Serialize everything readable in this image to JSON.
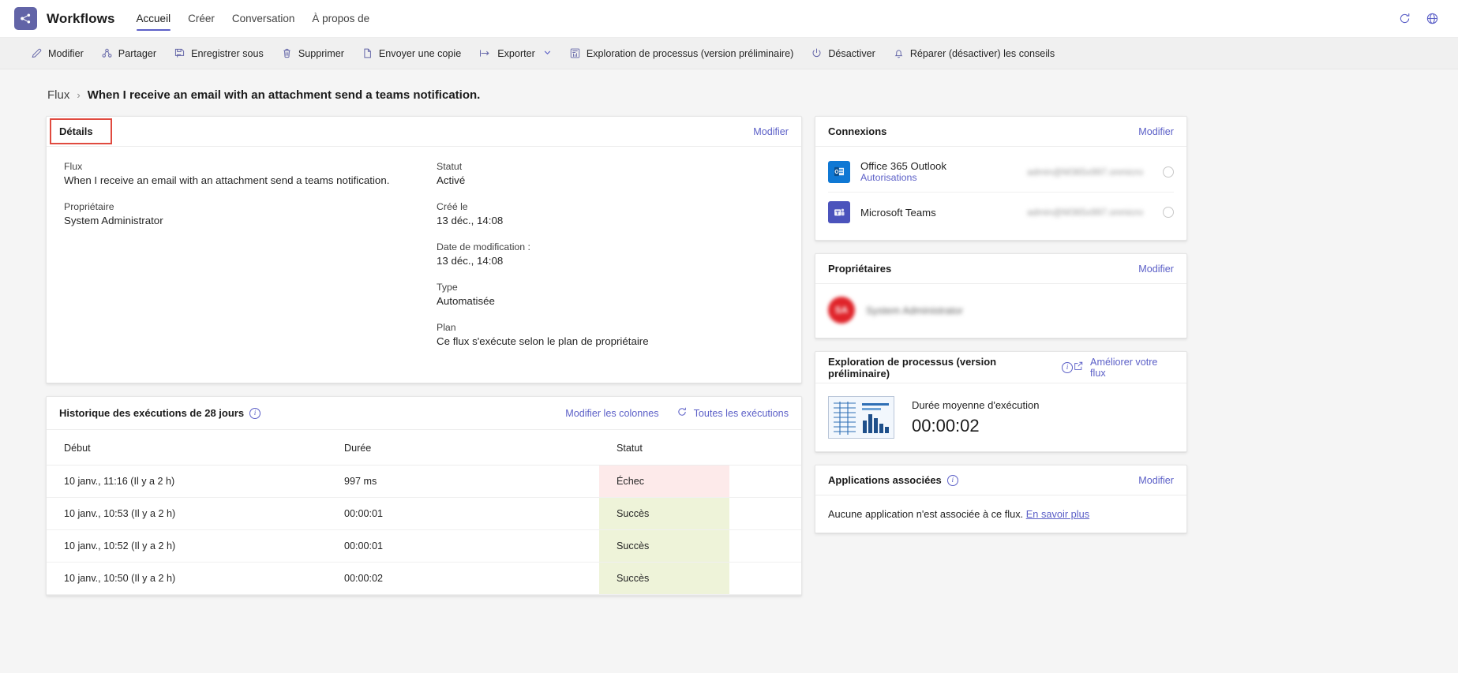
{
  "appbar": {
    "logo_icon": "workflows-logo-icon",
    "title": "Workflows",
    "nav": [
      {
        "label": "Accueil",
        "active": true
      },
      {
        "label": "Créer",
        "active": false
      },
      {
        "label": "Conversation",
        "active": false
      },
      {
        "label": "À propos de",
        "active": false
      }
    ],
    "refresh_icon": "refresh-icon",
    "globe_icon": "globe-icon"
  },
  "commandbar": {
    "items": [
      {
        "label": "Modifier",
        "icon": "pencil-icon",
        "chevron": false
      },
      {
        "label": "Partager",
        "icon": "share-icon",
        "chevron": false
      },
      {
        "label": "Enregistrer sous",
        "icon": "save-as-icon",
        "chevron": false
      },
      {
        "label": "Supprimer",
        "icon": "trash-icon",
        "chevron": false
      },
      {
        "label": "Envoyer une copie",
        "icon": "copy-icon",
        "chevron": false
      },
      {
        "label": "Exporter",
        "icon": "export-icon",
        "chevron": true
      },
      {
        "label": "Exploration de processus (version préliminaire)",
        "icon": "process-advisor-icon",
        "chevron": false
      },
      {
        "label": "Désactiver",
        "icon": "power-icon",
        "chevron": false
      },
      {
        "label": "Réparer (désactiver) les conseils",
        "icon": "bell-icon",
        "chevron": false
      }
    ]
  },
  "breadcrumb": {
    "root": "Flux",
    "separator": "›",
    "current": "When I receive an email with an attachment send a teams notification."
  },
  "details": {
    "tab_label": "Détails",
    "edit_label": "Modifier",
    "left_fields": [
      {
        "key": "Flux",
        "value": "When I receive an email with an attachment send a teams notification."
      },
      {
        "key": "Propriétaire",
        "value": "System Administrator"
      }
    ],
    "right_fields": [
      {
        "key": "Statut",
        "value": "Activé"
      },
      {
        "key": "Créé le",
        "value": "13 déc., 14:08"
      },
      {
        "key": "Date de modification :",
        "value": "13 déc., 14:08"
      },
      {
        "key": "Type",
        "value": "Automatisée"
      },
      {
        "key": "Plan",
        "value": "Ce flux s'exécute selon le plan de propriétaire"
      }
    ]
  },
  "run_history": {
    "title": "Historique des exécutions de 28 jours",
    "info_icon": "info-icon",
    "edit_columns_label": "Modifier les colonnes",
    "refresh_label": "Toutes les exécutions",
    "refresh_icon": "refresh-icon",
    "columns": [
      "Début",
      "Durée",
      "Statut"
    ],
    "rows": [
      {
        "start": "10 janv., 11:16 (Il y a 2 h)",
        "duration": "997 ms",
        "status": "Échec",
        "state": "fail"
      },
      {
        "start": "10 janv., 10:53 (Il y a 2 h)",
        "duration": "00:00:01",
        "status": "Succès",
        "state": "ok"
      },
      {
        "start": "10 janv., 10:52 (Il y a 2 h)",
        "duration": "00:00:01",
        "status": "Succès",
        "state": "ok"
      },
      {
        "start": "10 janv., 10:50 (Il y a 2 h)",
        "duration": "00:00:02",
        "status": "Succès",
        "state": "ok"
      }
    ]
  },
  "connections": {
    "title": "Connexions",
    "edit_label": "Modifier",
    "items": [
      {
        "name": "Office 365 Outlook",
        "sub": "Autorisations",
        "email": "admin@M365x997.onmicro",
        "logo_text": "O",
        "logo_color": "#0f78d4",
        "icon": "outlook-icon"
      },
      {
        "name": "Microsoft Teams",
        "sub": "",
        "email": "admin@M365x997.onmicro",
        "logo_text": "T",
        "logo_color": "#4b53bc",
        "icon": "teams-icon"
      }
    ]
  },
  "owners": {
    "title": "Propriétaires",
    "edit_label": "Modifier",
    "items": [
      {
        "initials": "SA",
        "name": "System Administrator",
        "avatar_color": "#e0242a"
      }
    ]
  },
  "process_advisor": {
    "title": "Exploration de processus (version préliminaire)",
    "info_icon": "info-icon",
    "improve_label": "Améliorer votre flux",
    "improve_icon": "open-in-new-icon",
    "thumbnail_icon": "chart-thumbnail-icon",
    "metric_label": "Durée moyenne d'exécution",
    "metric_value": "00:00:02"
  },
  "associated_apps": {
    "title": "Applications associées",
    "info_icon": "info-icon",
    "edit_label": "Modifier",
    "body_text": "Aucune application n'est associée à ce flux.",
    "link_text": "En savoir plus"
  },
  "colors": {
    "accent": "#5b5fc7",
    "brand": "#6264a7",
    "highlight_box": "#e04a3f",
    "fail_bg": "#fdeaea",
    "success_bg": "#eef3d9"
  }
}
